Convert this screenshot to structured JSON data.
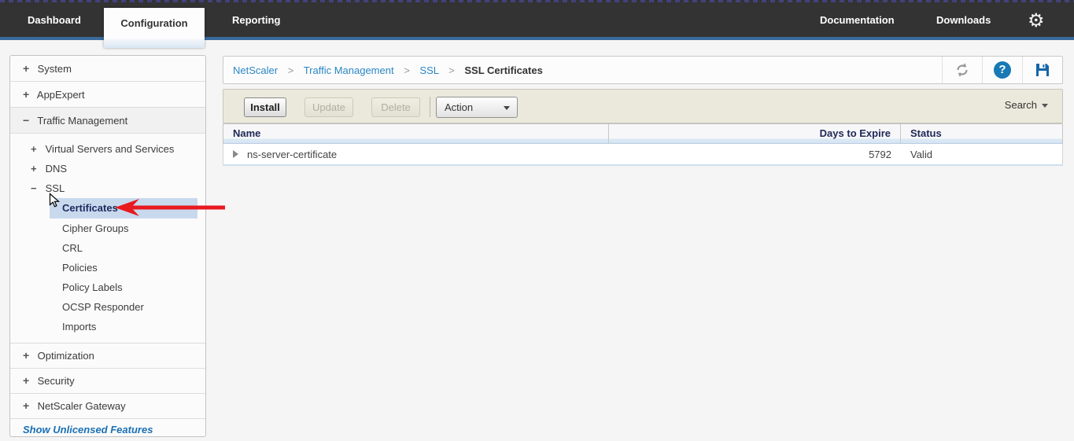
{
  "nav": {
    "tabs": [
      {
        "label": "Dashboard",
        "active": false
      },
      {
        "label": "Configuration",
        "active": true
      },
      {
        "label": "Reporting",
        "active": false
      }
    ],
    "links": [
      {
        "label": "Documentation"
      },
      {
        "label": "Downloads"
      }
    ],
    "icons": {
      "gear": "⚙",
      "help": "?"
    }
  },
  "sidebar": {
    "sections_top": [
      {
        "label": "System",
        "expander": "+"
      },
      {
        "label": "AppExpert",
        "expander": "+"
      },
      {
        "label": "Traffic Management",
        "expander": "−"
      }
    ],
    "traffic_management_children": [
      {
        "label": "Virtual Servers and Services",
        "expander": "+"
      },
      {
        "label": "DNS",
        "expander": "+"
      },
      {
        "label": "SSL",
        "expander": "−"
      }
    ],
    "ssl_children": [
      {
        "label": "Certificates",
        "selected": true
      },
      {
        "label": "Cipher Groups"
      },
      {
        "label": "CRL"
      },
      {
        "label": "Policies"
      },
      {
        "label": "Policy Labels"
      },
      {
        "label": "OCSP Responder"
      },
      {
        "label": "Imports"
      }
    ],
    "sections_bottom": [
      {
        "label": "Optimization",
        "expander": "+"
      },
      {
        "label": "Security",
        "expander": "+"
      },
      {
        "label": "NetScaler Gateway",
        "expander": "+"
      }
    ],
    "footer_link": "Show Unlicensed Features"
  },
  "breadcrumb": {
    "separator": ">",
    "items": [
      {
        "label": "NetScaler"
      },
      {
        "label": "Traffic Management"
      },
      {
        "label": "SSL"
      }
    ],
    "current": "SSL Certificates"
  },
  "toolbar": {
    "install_label": "Install",
    "update_label": "Update",
    "delete_label": "Delete",
    "action_label": "Action",
    "search_label": "Search"
  },
  "table": {
    "columns": [
      {
        "label": "Name"
      },
      {
        "label": "Days to Expire"
      },
      {
        "label": "Status"
      }
    ],
    "rows": [
      {
        "name": "ns-server-certificate",
        "days_to_expire": "5792",
        "status": "Valid"
      }
    ]
  },
  "annotations": {
    "arrow_color": "#e8191f"
  },
  "colors": {
    "nav_bg": "#333333",
    "nav_accent_blue": "#3a6b9c",
    "toolbar_bg": "#ebe9dc",
    "selected_item_bg": "#c8d9ee",
    "link_blue": "#2b86c3",
    "table_header_text": "#202a56",
    "help_icon_bg": "#1879b5",
    "save_icon_blue": "#1465a7"
  }
}
